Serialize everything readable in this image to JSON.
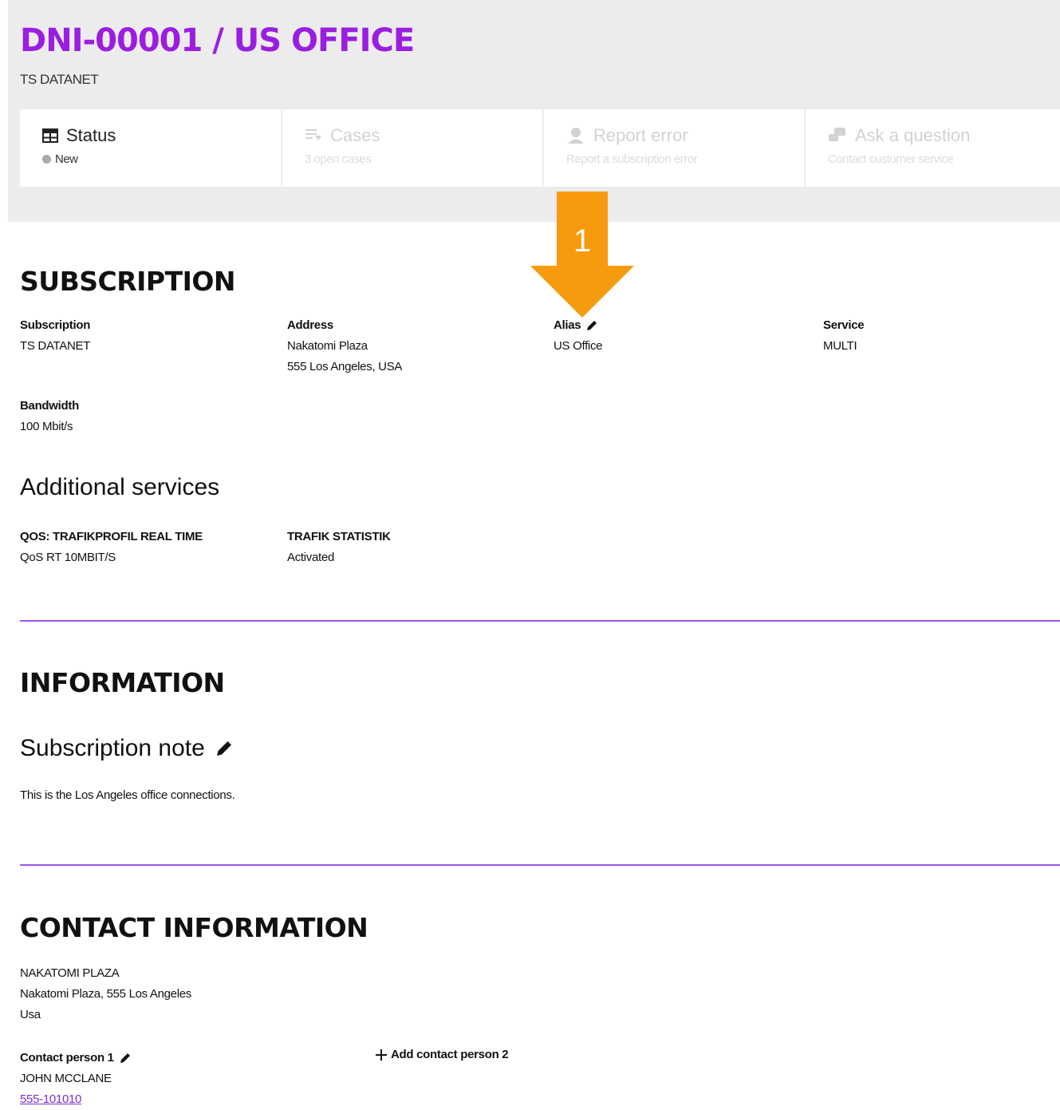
{
  "header": {
    "title": "DNI-00001 / US OFFICE",
    "subtitle": "TS DATANET"
  },
  "tabs": [
    {
      "label": "Status",
      "sub": "New",
      "icon": "table-icon",
      "active": true
    },
    {
      "label": "Cases",
      "sub": "3 open cases",
      "icon": "list-icon",
      "active": false
    },
    {
      "label": "Report error",
      "sub": "Report a subscription error",
      "icon": "person-icon",
      "active": false
    },
    {
      "label": "Ask a question",
      "sub": "Contact customer service",
      "icon": "chat-icon",
      "active": false
    }
  ],
  "annotation": {
    "number": "1",
    "color": "#f79a0e"
  },
  "subscription": {
    "heading": "SUBSCRIPTION",
    "subscription_label": "Subscription",
    "subscription_value": "TS DATANET",
    "address_label": "Address",
    "address_line1": "Nakatomi Plaza",
    "address_line2": "555 Los Angeles, USA",
    "alias_label": "Alias",
    "alias_value": "US Office",
    "service_label": "Service",
    "service_value": "MULTI",
    "bandwidth_label": "Bandwidth",
    "bandwidth_value": "100 Mbit/s"
  },
  "additional": {
    "heading": "Additional services",
    "items": [
      {
        "label": "QOS: TRAFIKPROFIL REAL TIME",
        "value": "QoS RT 10MBIT/S"
      },
      {
        "label": "TRAFIK STATISTIK",
        "value": "Activated"
      }
    ]
  },
  "information": {
    "heading": "INFORMATION",
    "note_heading": "Subscription note",
    "note_text": "This is the Los Angeles office connections."
  },
  "contact": {
    "heading": "CONTACT INFORMATION",
    "company": "NAKATOMI PLAZA",
    "address": "Nakatomi Plaza, 555 Los Angeles",
    "country": "Usa",
    "person1_label": "Contact person 1",
    "person1_name": "JOHN MCCLANE",
    "person1_phone": "555-101010",
    "add_person2": "Add contact person 2"
  },
  "colors": {
    "accent": "#9b1ee0",
    "divider": "#9b55ee",
    "arrow": "#f79a0e"
  }
}
